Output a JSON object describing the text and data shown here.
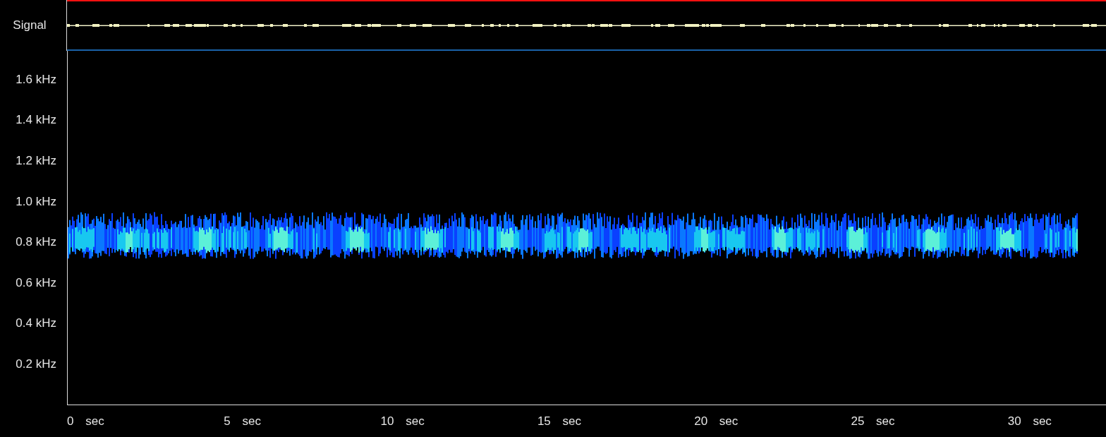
{
  "signal_label": "Signal",
  "y_axis_labels": [
    "1.6 kHz",
    "1.4 kHz",
    "1.2 kHz",
    "1.0 kHz",
    "0.8 kHz",
    "0.6 kHz",
    "0.4 kHz",
    "0.2 kHz"
  ],
  "x_axis_labels": [
    "0 sec",
    "5 sec",
    "10 sec",
    "15 sec",
    "20 sec",
    "25 sec",
    "30 sec"
  ]
}
